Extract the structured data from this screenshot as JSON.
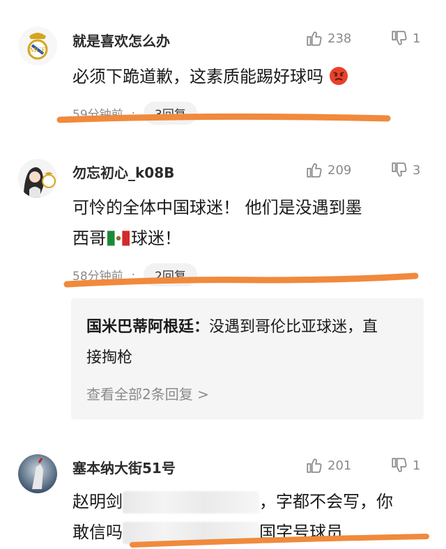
{
  "comments": [
    {
      "username": "就是喜欢怎么办",
      "likes": "238",
      "dislikes": "1",
      "text": "必须下跪道歉，这素质能踢好球吗",
      "emoji_icon": "angry-face-icon",
      "time": "59分钟前",
      "dot": "·",
      "replies": "3回复"
    },
    {
      "username": "勿忘初心_k08B",
      "likes": "209",
      "dislikes": "3",
      "text_line1": "可怜的全体中国球迷！ 他们是没遇到墨",
      "text_line2_a": "西哥",
      "flag_icon": "mexico-flag-icon",
      "text_line2_b": "球迷！",
      "time": "58分钟前",
      "dot": "·",
      "replies": "2回复",
      "reply_preview": {
        "author": "国米巴蒂阿根廷：",
        "text": "没遇到哥伦比亚球迷，直接掏枪",
        "view_all": "查看全部2条回复 >"
      }
    },
    {
      "username": "塞本纳大街51号",
      "likes": "201",
      "dislikes": "1",
      "text_a": "赵明剑",
      "text_b": "，字都不会写，你",
      "text_c": "敢信吗",
      "text_d": "国字号球员"
    }
  ],
  "colors": {
    "underline": "#f08a3c",
    "meta": "#8a8a8a",
    "reply_bg": "#f5f5f5",
    "real_madrid_gold": "#d4a520"
  }
}
